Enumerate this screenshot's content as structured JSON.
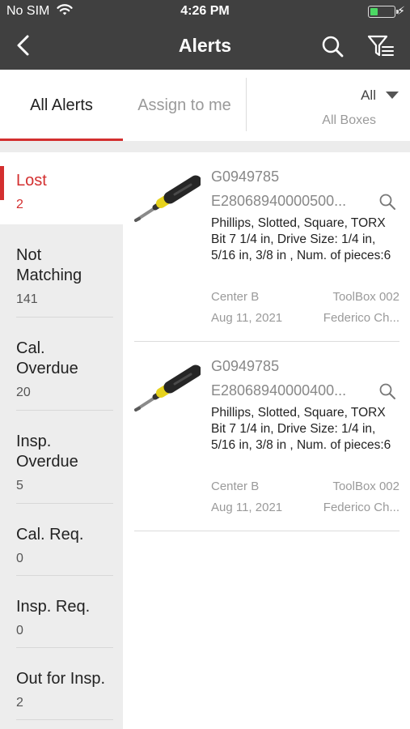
{
  "status_bar": {
    "carrier": "No SIM",
    "time": "4:26 PM",
    "icons": [
      "wifi-icon",
      "battery-icon",
      "charging-bolt-icon"
    ],
    "battery_color": "#4cd964"
  },
  "nav": {
    "title": "Alerts",
    "back_icon": "chevron-left-icon",
    "search_icon": "search-icon",
    "filter_icon": "filter-list-icon",
    "background": "#404040"
  },
  "tabs": {
    "all_alerts": "All Alerts",
    "assign_to_me": "Assign to me",
    "selected": "All Alerts",
    "accent": "#d32f2f"
  },
  "box_filter": {
    "selected": "All",
    "subtitle": "All Boxes"
  },
  "sidebar": {
    "items": [
      {
        "label": "Lost",
        "count": "2",
        "active": true
      },
      {
        "label": "Not Matching",
        "count": "141"
      },
      {
        "label": "Cal. Overdue",
        "count": "20"
      },
      {
        "label": "Insp. Overdue",
        "count": "5"
      },
      {
        "label": "Cal. Req.",
        "count": "0"
      },
      {
        "label": "Insp. Req.",
        "count": "0"
      },
      {
        "label": "Out for Insp.",
        "count": "2"
      }
    ]
  },
  "alerts": [
    {
      "code": "G0949785",
      "epc": "E28068940000500...",
      "description": "Phillips, Slotted, Square, TORX Bit 7 1/4 in, Drive Size: 1/4 in, 5/16 in, 3/8 in , Num. of pieces:6",
      "location": "Center B",
      "box": "ToolBox 002",
      "date": "Aug 11, 2021",
      "owner": "Federico Ch..."
    },
    {
      "code": "G0949785",
      "epc": "E28068940000400...",
      "description": "Phillips, Slotted, Square, TORX Bit 7 1/4 in, Drive Size: 1/4 in, 5/16 in, 3/8 in , Num. of pieces:6",
      "location": "Center B",
      "box": "ToolBox 002",
      "date": "Aug 11, 2021",
      "owner": "Federico Ch..."
    }
  ]
}
